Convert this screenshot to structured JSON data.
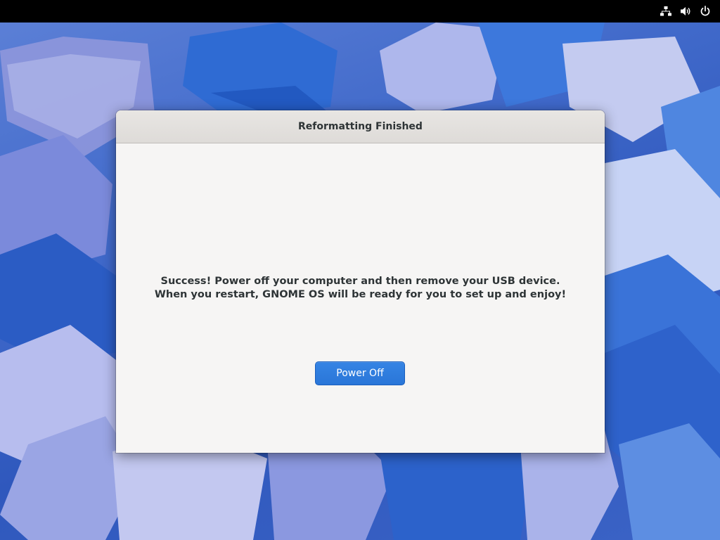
{
  "topbar": {
    "icons": [
      "network-wired-icon",
      "volume-icon",
      "power-icon"
    ]
  },
  "dialog": {
    "title": "Reformatting Finished",
    "message": "Success! Power off your computer and then remove your USB device. When you restart, GNOME OS will be ready for you to set up and enjoy!",
    "primary_button_label": "Power Off"
  },
  "colors": {
    "accent": "#3584e4",
    "topbar": "#000000",
    "dialog_bg": "#f6f5f4",
    "text": "#2e3436"
  }
}
